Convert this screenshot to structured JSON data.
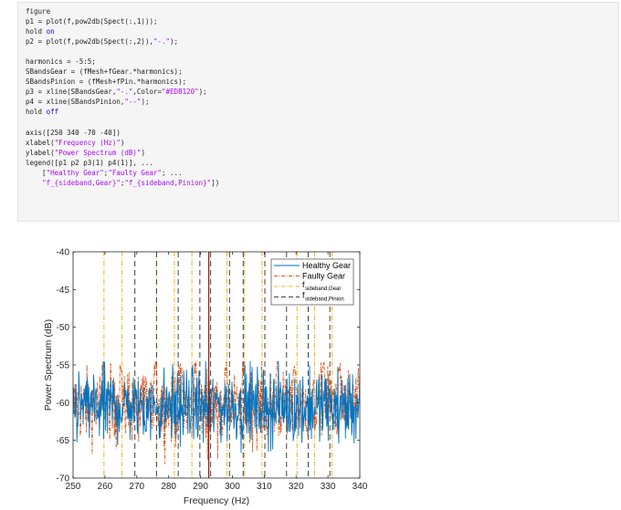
{
  "code": {
    "lines": [
      [
        {
          "t": "figure"
        }
      ],
      [
        {
          "t": "p1 = plot(f,pow2db(Spect(:,1)));"
        }
      ],
      [
        {
          "t": "hold "
        },
        {
          "t": "on",
          "c": "kw"
        }
      ],
      [
        {
          "t": "p2 = plot(f,pow2db(Spect(:,2)),"
        },
        {
          "t": "\"-.\"",
          "c": "str"
        },
        {
          "t": ");"
        }
      ],
      [],
      [
        {
          "t": "harmonics = -5:5;"
        }
      ],
      [
        {
          "t": "SBandsGear = (fMesh+fGear.*harmonics);"
        }
      ],
      [
        {
          "t": "SBandsPinion = (fMesh+fPin.*harmonics);"
        }
      ],
      [
        {
          "t": "p3 = xline(SBandsGear,"
        },
        {
          "t": "\"-.\"",
          "c": "str"
        },
        {
          "t": ",Color="
        },
        {
          "t": "\"#EDB120\"",
          "c": "str"
        },
        {
          "t": ");"
        }
      ],
      [
        {
          "t": "p4 = xline(SBandsPinion,"
        },
        {
          "t": "\"--\"",
          "c": "str"
        },
        {
          "t": ");"
        }
      ],
      [
        {
          "t": "hold "
        },
        {
          "t": "off",
          "c": "kw"
        }
      ],
      [],
      [
        {
          "t": "axis([250 340 -70 -40])"
        }
      ],
      [
        {
          "t": "xlabel("
        },
        {
          "t": "\"Frequency (Hz)\"",
          "c": "str"
        },
        {
          "t": ")"
        }
      ],
      [
        {
          "t": "ylabel("
        },
        {
          "t": "\"Power Spectrum (dB)\"",
          "c": "str"
        },
        {
          "t": ")"
        }
      ],
      [
        {
          "t": "legend([p1 p2 p3(1) p4(1)], ..."
        }
      ],
      [
        {
          "t": "    ["
        },
        {
          "t": "\"Healthy Gear\"",
          "c": "str"
        },
        {
          "t": ";"
        },
        {
          "t": "\"Faulty Gear\"",
          "c": "str"
        },
        {
          "t": "; ..."
        }
      ],
      [
        {
          "t": "    "
        },
        {
          "t": "\"f_{sideband,Gear}\"",
          "c": "str"
        },
        {
          "t": ";"
        },
        {
          "t": "\"f_{sideband,Pinion}\"",
          "c": "str"
        },
        {
          "t": "])"
        }
      ]
    ]
  },
  "chart_data": {
    "type": "line",
    "xlabel": "Frequency (Hz)",
    "ylabel": "Power Spectrum (dB)",
    "xlim": [
      250,
      340
    ],
    "ylim": [
      -70,
      -40
    ],
    "xticks": [
      250,
      260,
      270,
      280,
      290,
      300,
      310,
      320,
      330,
      340
    ],
    "yticks": [
      -40,
      -45,
      -50,
      -55,
      -60,
      -65,
      -70
    ],
    "grid": false,
    "legend_position": "top-right",
    "legend": [
      {
        "label": "Healthy Gear",
        "color": "#0072BD",
        "dash": "solid"
      },
      {
        "label": "Faulty Gear",
        "color": "#D95319",
        "dash": "dashdot"
      },
      {
        "label_main": "f",
        "label_sub": "sideband,Gear",
        "color": "#EDB120",
        "dash": "dashdot"
      },
      {
        "label_main": "f",
        "label_sub": "sideband,Pinion",
        "color": "#404040",
        "dash": "dashed"
      }
    ],
    "series_colors": {
      "healthy": "#0072BD",
      "faulty": "#D95319",
      "sideband_gear": "#EDB120",
      "sideband_pinion": "#404040"
    },
    "series": [
      {
        "name": "Healthy Gear",
        "x_range": [
          250,
          340
        ],
        "points": 600,
        "mean": -60.5,
        "spread": 3.2,
        "min": -68.5,
        "max": -54.5
      },
      {
        "name": "Faulty Gear",
        "x_range": [
          250,
          340
        ],
        "points": 600,
        "mean": -60.5,
        "spread": 3.2,
        "min": -68.5,
        "max": -54.5,
        "peaks": [
          259.5,
          265,
          276,
          284,
          288.5,
          298,
          303.5,
          314,
          319.5,
          328.5,
          333.5
        ]
      },
      {
        "name": "f_{sideband,Gear}",
        "xlines": [
          259.7,
          265.4,
          276.2,
          281.8,
          287.3,
          298.3,
          303.8,
          309.3,
          320.3,
          325.8,
          331.3
        ]
      },
      {
        "name": "f_{sideband,Pinion}",
        "xlines": [
          269.4,
          276.2,
          283.0,
          289.8,
          299.1,
          303.4,
          310.2,
          317.0,
          323.8,
          330.6
        ]
      }
    ],
    "center_line_x": 292.6
  }
}
